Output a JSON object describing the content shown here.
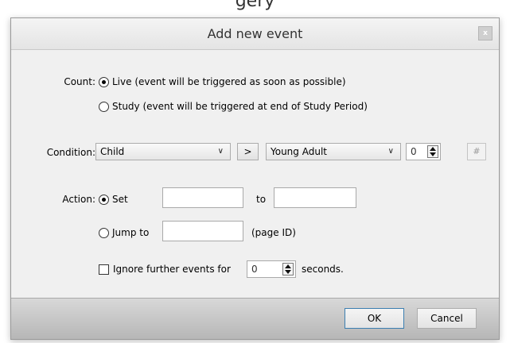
{
  "background": {
    "title_fragment": "gery"
  },
  "dialog": {
    "title": "Add new event",
    "close_label": "x",
    "count": {
      "label": "Count:",
      "options": [
        {
          "label": "Live (event will be triggered as soon as possible)",
          "selected": true
        },
        {
          "label": "Study (event will be triggered at end of Study Period)",
          "selected": false
        }
      ]
    },
    "condition": {
      "label": "Condition:",
      "left_select": "Child",
      "operator": ">",
      "right_select": "Young Adult",
      "number": "0",
      "hash_label": "#"
    },
    "action": {
      "label": "Action:",
      "set_label": "Set",
      "set_selected": true,
      "set_from_value": "",
      "to_label": "to",
      "set_to_value": "",
      "jump_label": "Jump to",
      "jump_selected": false,
      "jump_value": "",
      "page_id_label": "(page ID)"
    },
    "ignore": {
      "checked": false,
      "label": "Ignore further events for",
      "value": "0",
      "suffix": "seconds."
    },
    "buttons": {
      "ok": "OK",
      "cancel": "Cancel"
    }
  },
  "colors": {
    "accent_border": "#3c7fb1",
    "dialog_bg": "#f0f0f0",
    "footer": "#c4c4c4"
  },
  "icons": [
    "close-icon",
    "chevron-down-icon",
    "spin-up-icon",
    "spin-down-icon"
  ]
}
